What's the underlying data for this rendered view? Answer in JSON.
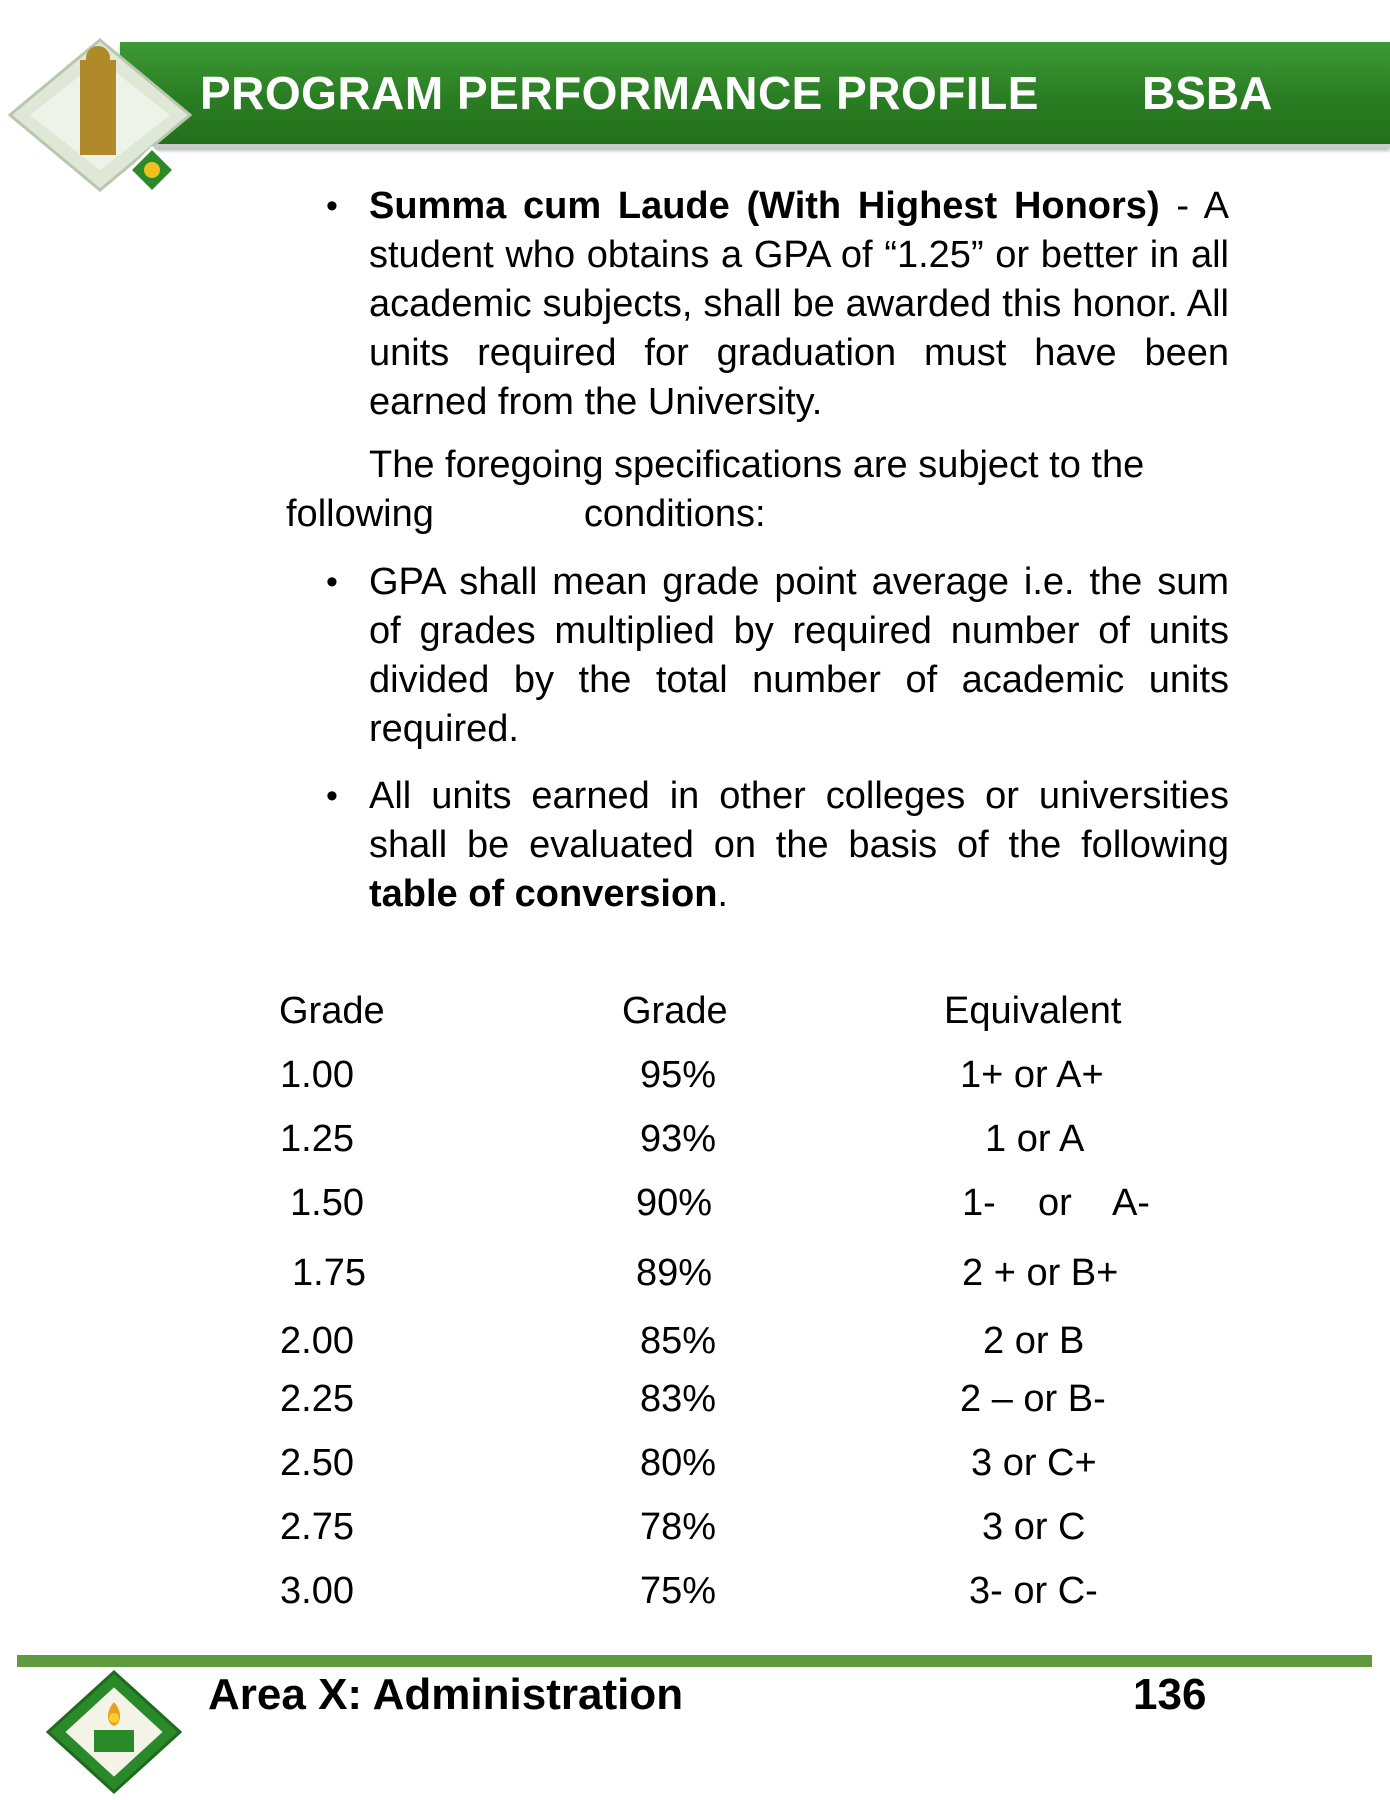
{
  "header": {
    "title": "PROGRAM PERFORMANCE PROFILE",
    "program": "BSBA"
  },
  "summa": {
    "heading": "Summa cum Laude (With Highest Honors)",
    "dash": " -",
    "text": "A student who obtains a GPA of “1.25” or better in all academic subjects, shall be awarded this honor. All units required for graduation must have been earned from the University."
  },
  "foregoing": {
    "text_start": "The foregoing specifications are subject to the following",
    "text_end": "conditions:"
  },
  "gpa_bullet": {
    "text": "GPA shall mean grade point average i.e. the sum of grades multiplied by required number of units divided by the total number of academic units required."
  },
  "units_bullet": {
    "text": "All units earned in other colleges or universities shall be evaluated on the basis of the following",
    "bold": "table of conversion",
    "end": "."
  },
  "bullet_char": "•",
  "table": {
    "headers": [
      "Grade",
      "Grade",
      "Equivalent"
    ],
    "rows": [
      [
        "1.00",
        "95%",
        "1+ or A+"
      ],
      [
        "1.25",
        "93%",
        "1 or A"
      ],
      [
        "1.50",
        "90%",
        "1-    or    A-"
      ],
      [
        "1.75",
        "89%",
        "2 + or B+"
      ],
      [
        "2.00",
        "85%",
        "2 or B"
      ],
      [
        "2.25",
        "83%",
        "2 – or B-"
      ],
      [
        "2.50",
        "80%",
        "3 or C+"
      ],
      [
        "2.75",
        "78%",
        "3 or C"
      ],
      [
        "3.00",
        "75%",
        "3- or C-"
      ]
    ]
  },
  "footer": {
    "area": "Area X: Administration",
    "page": "136"
  },
  "colors": {
    "header_green": "#2a7d22",
    "footer_line": "#5f9a3f"
  }
}
